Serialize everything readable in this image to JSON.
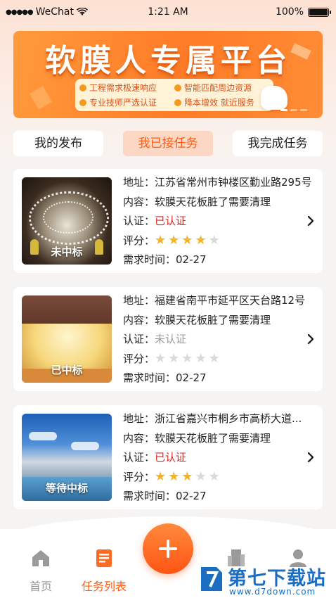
{
  "status_bar": {
    "carrier": "WeChat",
    "time": "1:21 AM",
    "battery": "100%"
  },
  "banner": {
    "title": "软膜人专属平台",
    "points": [
      "工程需求极速响应",
      "智能匹配周边资源",
      "专业技师严选认证",
      "降本增效 就近服务"
    ]
  },
  "tabs": [
    {
      "label": "我的发布",
      "active": false
    },
    {
      "label": "我已接任务",
      "active": true
    },
    {
      "label": "我完成任务",
      "active": false
    }
  ],
  "tasks": [
    {
      "tag": "未中标",
      "address_label": "地址：",
      "address": "江苏省常州市钟楼区勤业路295号",
      "content_label": "内容：",
      "content": "软膜天花板脏了需要清理",
      "cert_label": "认证：",
      "cert": "已认证",
      "certified": true,
      "rating_label": "评分：",
      "rating": 4,
      "time_label": "需求时间：",
      "time": "02-27"
    },
    {
      "tag": "已中标",
      "address_label": "地址：",
      "address": "福建省南平市延平区天台路12号",
      "content_label": "内容：",
      "content": "软膜天花板脏了需要清理",
      "cert_label": "认证：",
      "cert": "未认证",
      "certified": false,
      "rating_label": "评分：",
      "rating": 0,
      "time_label": "需求时间：",
      "time": "02-27"
    },
    {
      "tag": "等待中标",
      "address_label": "地址：",
      "address": "浙江省嘉兴市桐乡市高桥大道...",
      "content_label": "内容：",
      "content": "软膜天花板脏了需要清理",
      "cert_label": "认证：",
      "cert": "已认证",
      "certified": true,
      "rating_label": "评分：",
      "rating": 3,
      "time_label": "需求时间：",
      "time": "02-27"
    }
  ],
  "rating_max": 5,
  "bottom_nav": [
    {
      "label": "首页",
      "icon": "home-icon",
      "active": false
    },
    {
      "label": "任务列表",
      "icon": "task-list-icon",
      "active": true
    }
  ],
  "watermark": {
    "text": "第七下载站",
    "url": "www.d7down.com"
  },
  "colors": {
    "accent": "#ff5a12",
    "star_on": "#f5b323",
    "star_off": "#d9d9d9",
    "certified": "#e02424",
    "uncertified": "#999999"
  }
}
